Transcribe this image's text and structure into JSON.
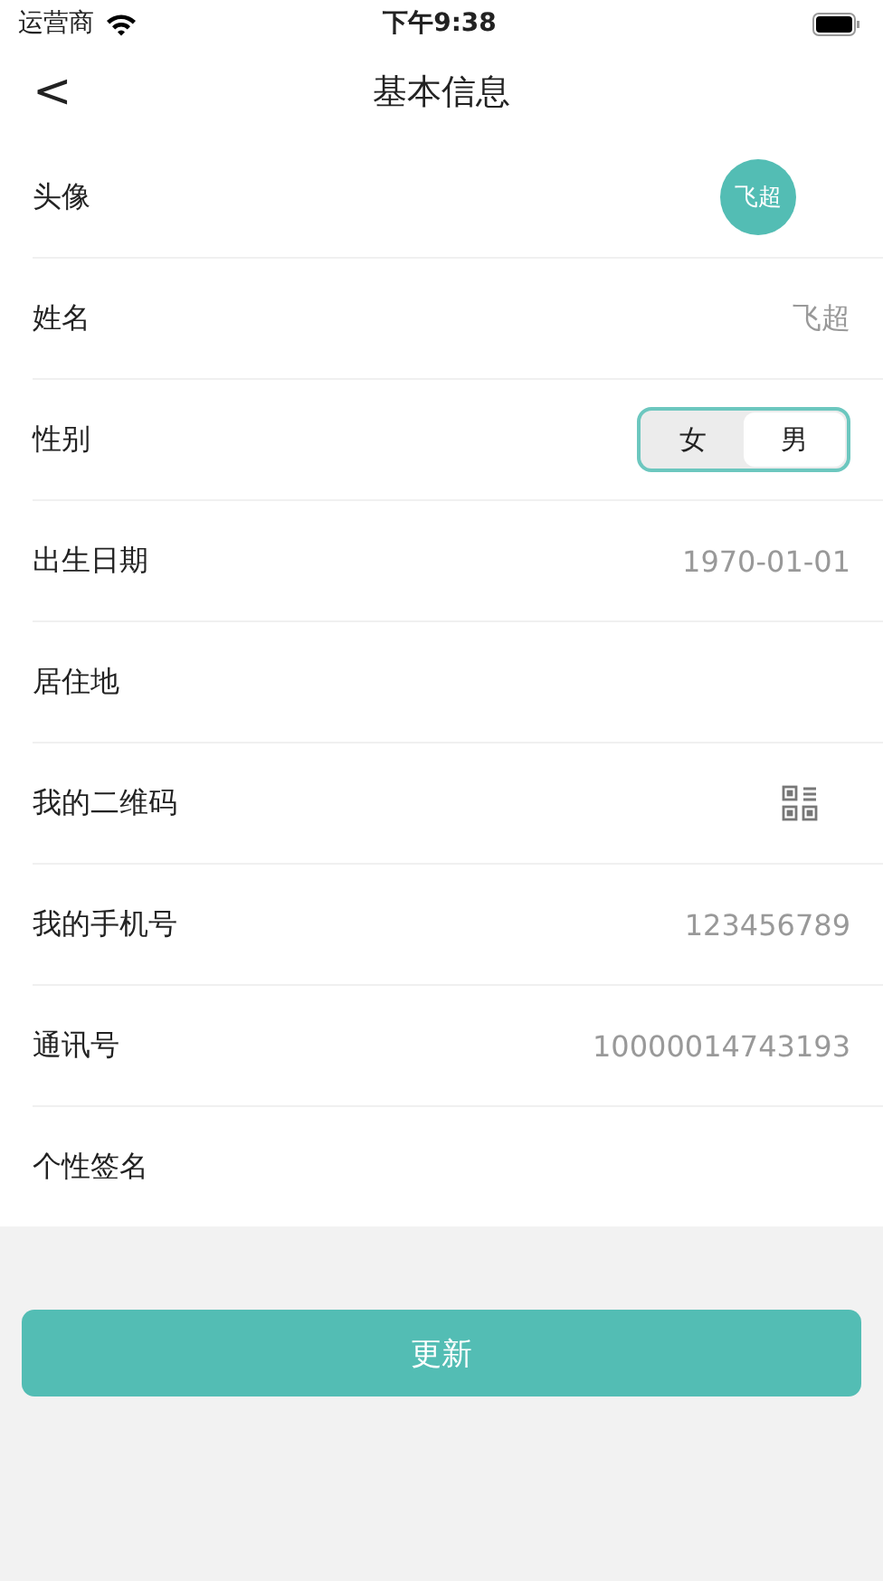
{
  "status_bar": {
    "carrier": "运营商",
    "time": "下午9:38"
  },
  "nav": {
    "back": "<",
    "title": "基本信息"
  },
  "rows": [
    {
      "kind": "avatar",
      "label": "头像",
      "value": "飞超"
    },
    {
      "kind": "text",
      "label": "姓名",
      "value": "飞超"
    },
    {
      "kind": "segment",
      "label": "性别",
      "options": [
        {
          "label": "女",
          "selected": false
        },
        {
          "label": "男",
          "selected": true
        }
      ]
    },
    {
      "kind": "text",
      "label": "出生日期",
      "value": "1970-01-01"
    },
    {
      "kind": "text",
      "label": "居住地"
    },
    {
      "kind": "qr",
      "label": "我的二维码"
    },
    {
      "kind": "text",
      "label": "我的手机号",
      "value": "123456789"
    },
    {
      "kind": "text",
      "label": "通讯号",
      "value": "10000014743193"
    },
    {
      "kind": "text",
      "label": "个性签名"
    }
  ],
  "update_button": "更新"
}
